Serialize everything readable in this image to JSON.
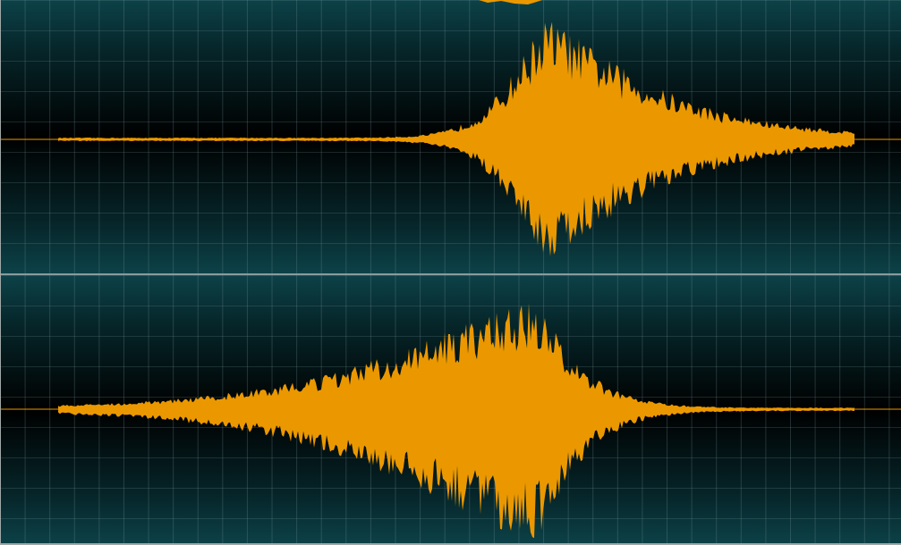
{
  "editor": {
    "channels": [
      {
        "id": "top",
        "label": ""
      },
      {
        "id": "bottom",
        "label": ""
      }
    ]
  },
  "colors": {
    "waveform": "#EB9800",
    "background_edge": "#0C4248",
    "background_center": "#000000",
    "grid": "#5E7A7E"
  }
}
